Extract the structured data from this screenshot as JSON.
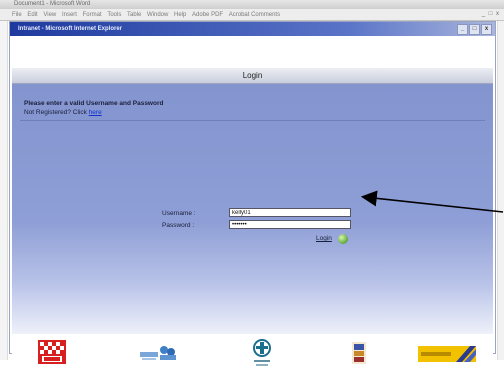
{
  "outer_window": {
    "title": "Document1 - Microsoft Word",
    "menu": [
      "File",
      "Edit",
      "View",
      "Insert",
      "Format",
      "Tools",
      "Table",
      "Window",
      "Help",
      "Adobe PDF",
      "Acrobat Comments"
    ],
    "controls": "_ □ x"
  },
  "ie_window": {
    "title": "Intranet - Microsoft Internet Explorer",
    "controls": [
      "_",
      "□",
      "x"
    ]
  },
  "login": {
    "header": "Login",
    "instructions": "Please enter a valid Username and Password",
    "not_registered": "Not Registered? Click",
    "here_link": "here",
    "username_label": "Username :",
    "username_value": "kelly01",
    "password_label": "Password :",
    "password_value": "•••••••",
    "login_link": "Login"
  },
  "footer_logos": [
    "logo-1",
    "logo-2",
    "logo-3",
    "logo-4",
    "logo-5"
  ],
  "colors": {
    "panel": "#8e9ed6",
    "ie_title": "#1e3a9e",
    "link": "#1233cc",
    "go_button": "#5ea83a"
  }
}
